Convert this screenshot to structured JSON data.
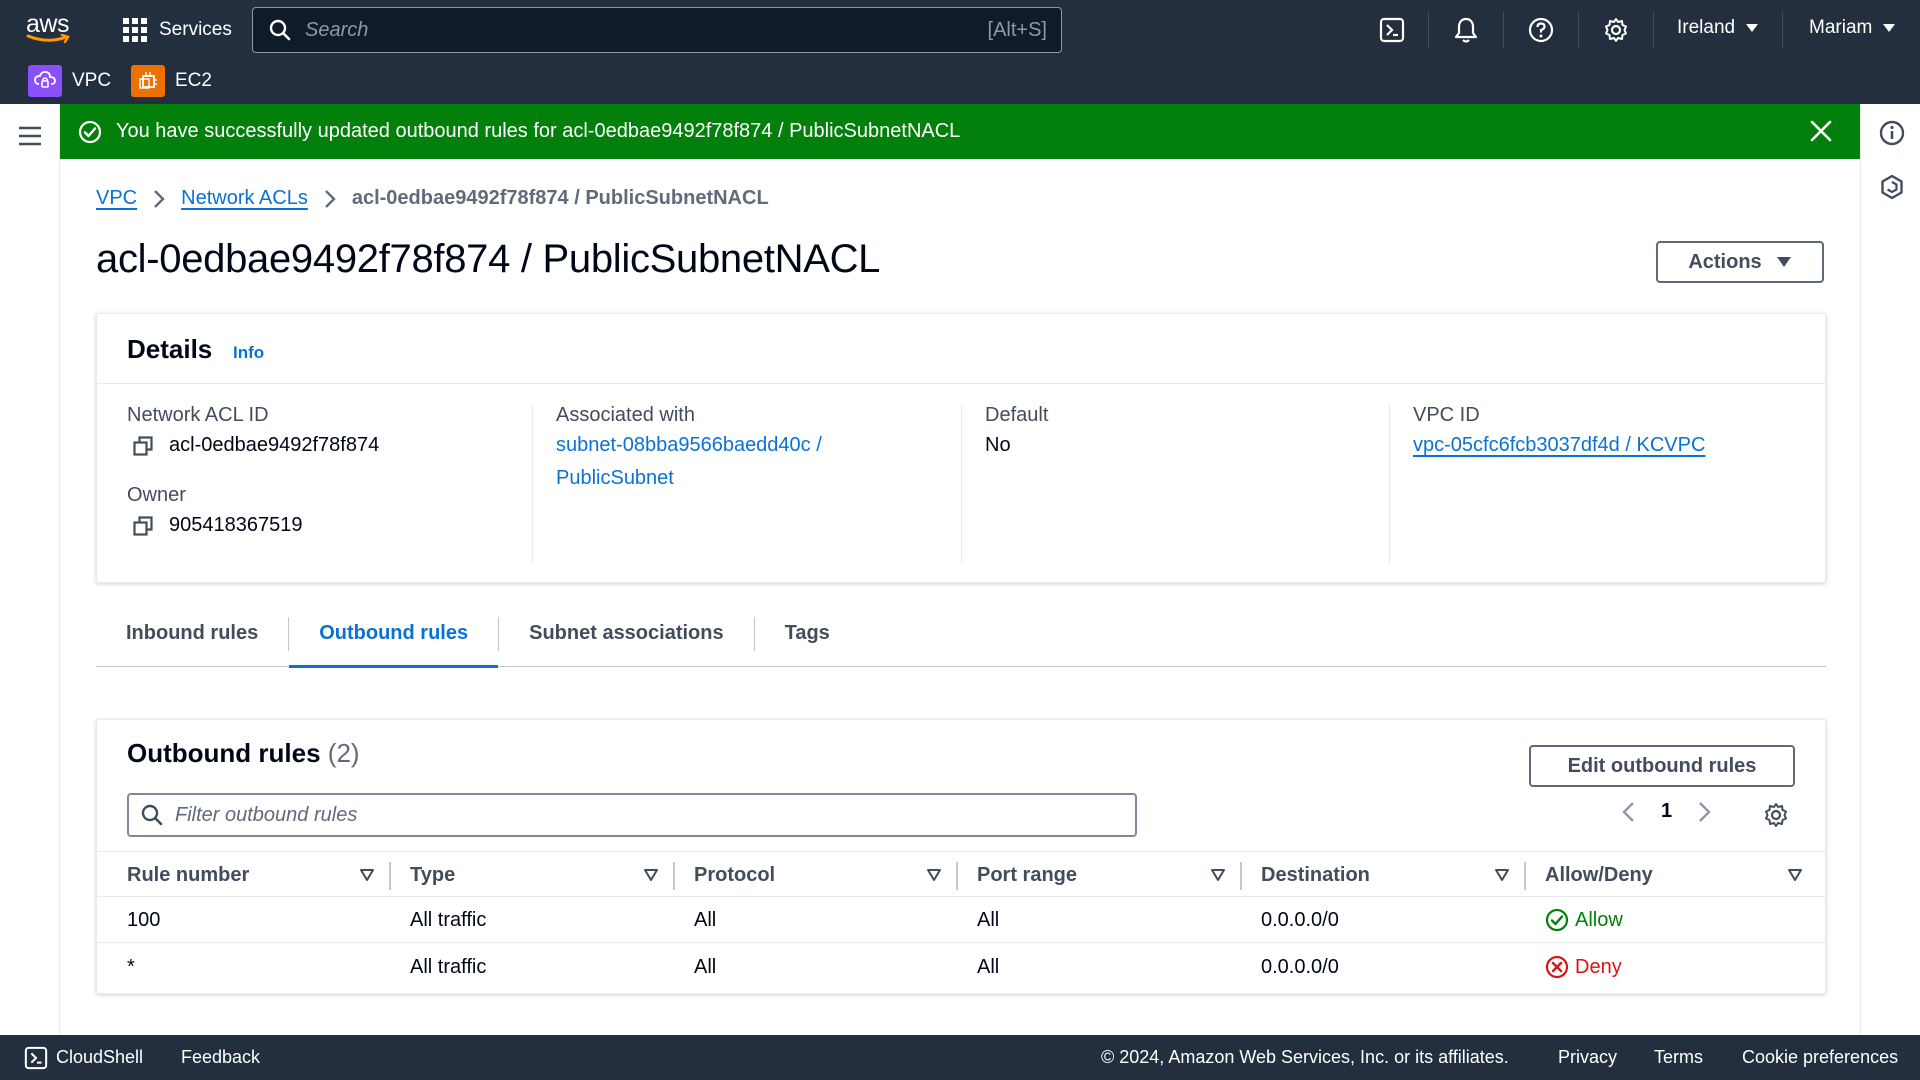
{
  "topnav": {
    "logo_text": "aws",
    "services_label": "Services",
    "search_placeholder": "Search",
    "search_shortcut": "[Alt+S]",
    "region_label": "Ireland",
    "user_label": "Mariam"
  },
  "favorites": [
    {
      "label": "VPC",
      "color": "#8c4fff"
    },
    {
      "label": "EC2",
      "color": "#ed7100"
    }
  ],
  "flash": {
    "message": "You have successfully updated outbound rules for acl-0edbae9492f78f874 / PublicSubnetNACL",
    "color": "#037f0c"
  },
  "breadcrumb": {
    "items": [
      "VPC",
      "Network ACLs"
    ],
    "current": "acl-0edbae9492f78f874 / PublicSubnetNACL"
  },
  "page": {
    "title": "acl-0edbae9492f78f874 / PublicSubnetNACL",
    "actions_label": "Actions"
  },
  "details": {
    "title": "Details",
    "info_label": "Info",
    "network_acl_id_label": "Network ACL ID",
    "network_acl_id": "acl-0edbae9492f78f874",
    "owner_label": "Owner",
    "owner": "905418367519",
    "associated_label": "Associated with",
    "associated_line1": "subnet-08bba9566baedd40c /",
    "associated_line2": "PublicSubnet",
    "default_label": "Default",
    "default_value": "No",
    "vpc_id_label": "VPC ID",
    "vpc_id": "vpc-05cfc6fcb3037df4d / KCVPC"
  },
  "tabs": [
    "Inbound rules",
    "Outbound rules",
    "Subnet associations",
    "Tags"
  ],
  "rules": {
    "title": "Outbound rules",
    "count": "(2)",
    "edit_label": "Edit outbound rules",
    "filter_placeholder": "Filter outbound rules",
    "page": "1",
    "columns": [
      "Rule number",
      "Type",
      "Protocol",
      "Port range",
      "Destination",
      "Allow/Deny"
    ],
    "rows": [
      {
        "rule": "100",
        "type": "All traffic",
        "protocol": "All",
        "port": "All",
        "destination": "0.0.0.0/0",
        "action": "Allow"
      },
      {
        "rule": "*",
        "type": "All traffic",
        "protocol": "All",
        "port": "All",
        "destination": "0.0.0.0/0",
        "action": "Deny"
      }
    ]
  },
  "footer": {
    "cloudshell": "CloudShell",
    "feedback": "Feedback",
    "copyright": "© 2024, Amazon Web Services, Inc. or its affiliates.",
    "privacy": "Privacy",
    "terms": "Terms",
    "cookies": "Cookie preferences"
  }
}
